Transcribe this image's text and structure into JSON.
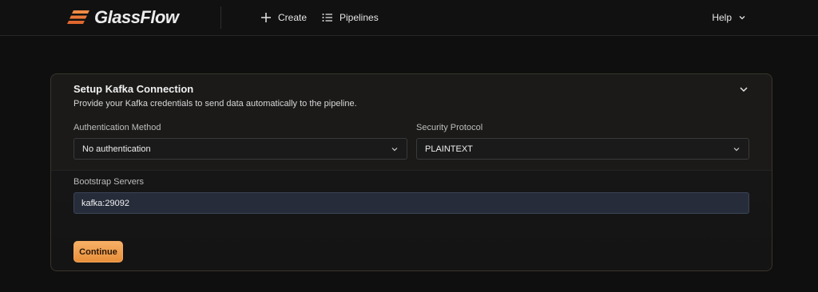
{
  "app": {
    "logo_text": "GlassFlow"
  },
  "nav": {
    "create_label": "Create",
    "pipelines_label": "Pipelines",
    "help_label": "Help"
  },
  "card": {
    "title": "Setup Kafka Connection",
    "subtitle": "Provide your Kafka credentials to send data automatically to the pipeline.",
    "auth": {
      "label": "Authentication Method",
      "value": "No authentication"
    },
    "security": {
      "label": "Security Protocol",
      "value": "PLAINTEXT"
    },
    "bootstrap": {
      "label": "Bootstrap Servers",
      "value": "kafka:29092"
    },
    "continue_label": "Continue"
  },
  "colors": {
    "accent": "#f0a050",
    "logo_mark": "#ec7a3a",
    "background": "#0f0f0f"
  }
}
